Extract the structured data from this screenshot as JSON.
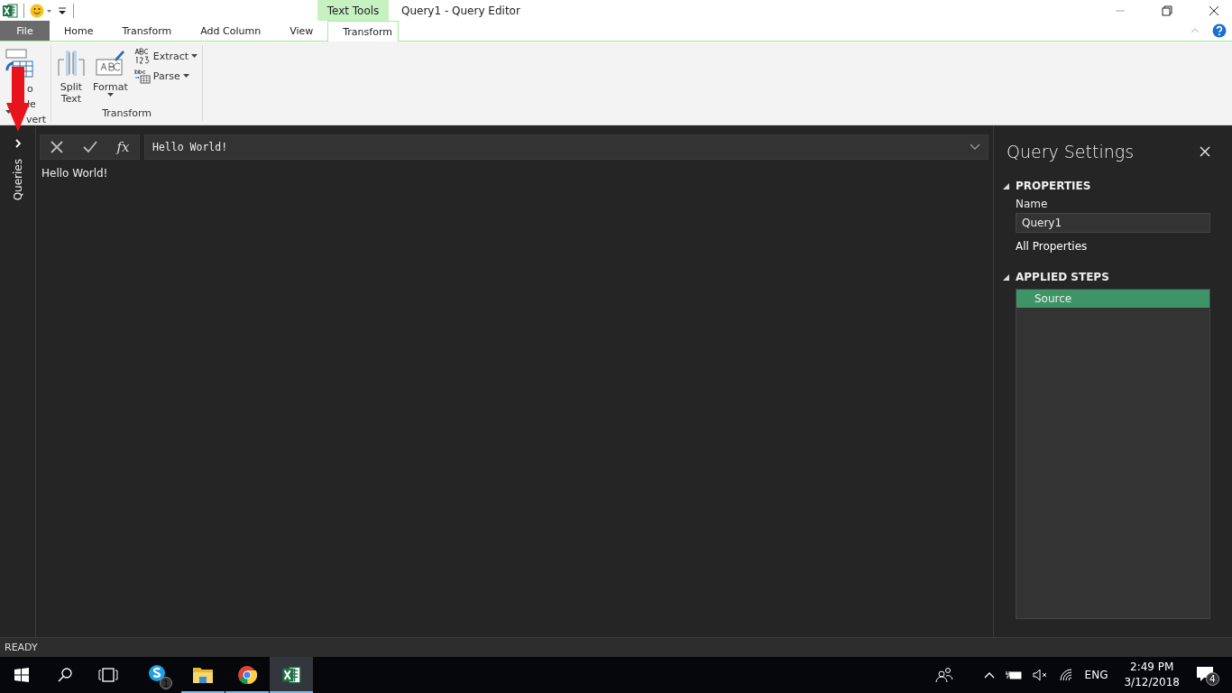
{
  "title_bar": {
    "contextual_tab_group": "Text Tools",
    "title": "Query1 - Query Editor"
  },
  "ribbon_tabs": [
    {
      "label": "File",
      "kind": "file",
      "selected": false
    },
    {
      "label": "Home",
      "kind": "tab",
      "selected": false
    },
    {
      "label": "Transform",
      "kind": "tab",
      "selected": false
    },
    {
      "label": "Add Column",
      "kind": "tab",
      "selected": false
    },
    {
      "label": "View",
      "kind": "tab",
      "selected": false
    },
    {
      "label": "Transform",
      "kind": "contextual",
      "selected": true
    }
  ],
  "ribbon_groups": [
    {
      "label": "vert",
      "buttons": [
        {
          "label_lines": [
            "o",
            "le"
          ],
          "kind": "large",
          "dropdown": true
        }
      ]
    },
    {
      "label": "Transform",
      "buttons": [
        {
          "label": "Split Text",
          "kind": "large",
          "dropdown": false
        },
        {
          "label": "Format",
          "kind": "large",
          "dropdown": true
        },
        {
          "label": "Extract",
          "kind": "small",
          "dropdown": true
        },
        {
          "label": "Parse",
          "kind": "small",
          "dropdown": true
        }
      ]
    }
  ],
  "queries_pane": {
    "label": "Queries",
    "expanded": false
  },
  "formula_bar": {
    "function_label": "fx",
    "value": "Hello World!"
  },
  "result": "Hello World!",
  "query_settings": {
    "title": "Query Settings",
    "properties": {
      "heading": "PROPERTIES",
      "expanded": true,
      "name_label": "Name",
      "name_value": "Query1",
      "link": "All Properties"
    },
    "applied_steps": {
      "heading": "APPLIED STEPS",
      "expanded": true,
      "steps": [
        {
          "label": "Source",
          "selected": true
        }
      ]
    }
  },
  "status_bar": "READY",
  "taskbar": {
    "apps": [
      {
        "kind": "skype",
        "badge": "1",
        "running": false,
        "selected": false
      },
      {
        "kind": "folder",
        "running": true,
        "selected": false
      },
      {
        "kind": "chrome",
        "running": true,
        "selected": false
      },
      {
        "kind": "excel",
        "running": true,
        "selected": true
      }
    ],
    "tray": {
      "language": "ENG",
      "time": "2:49 PM",
      "date": "3/12/2018",
      "notifications": "4"
    }
  }
}
